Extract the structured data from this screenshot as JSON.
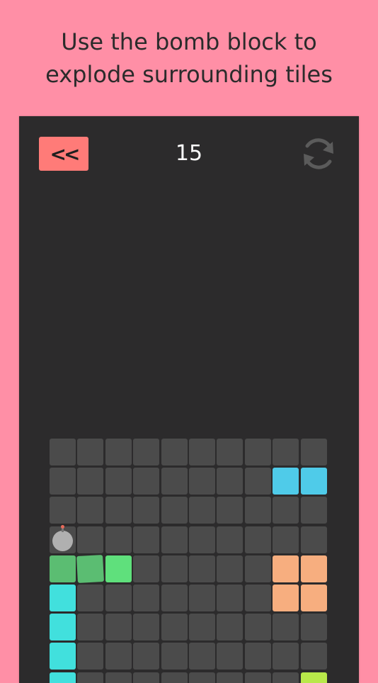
{
  "caption": {
    "line1": "Use the bomb block to",
    "line2": "explode surrounding tiles"
  },
  "header": {
    "back_label": "<<",
    "moves_count": "15",
    "restart_icon": "refresh-icon"
  },
  "board": {
    "columns": 10,
    "visible_rows": 9,
    "colors": {
      "empty": "#4b4b4b",
      "blue": "#4fcbe9",
      "cyan": "#41e0dd",
      "green": "#5bbd72",
      "light_green": "#5fe07c",
      "orange": "#f7ae7f",
      "lime": "#b8e84a",
      "bomb": "#b0b0b0"
    },
    "special_tiles": [
      {
        "row": 1,
        "col": 8,
        "color": "blue"
      },
      {
        "row": 1,
        "col": 9,
        "color": "blue"
      },
      {
        "row": 3,
        "col": 0,
        "color": "bomb"
      },
      {
        "row": 4,
        "col": 0,
        "color": "green"
      },
      {
        "row": 4,
        "col": 1,
        "color": "green",
        "tilted": true
      },
      {
        "row": 4,
        "col": 2,
        "color": "light_green"
      },
      {
        "row": 4,
        "col": 8,
        "color": "orange"
      },
      {
        "row": 4,
        "col": 9,
        "color": "orange"
      },
      {
        "row": 5,
        "col": 0,
        "color": "cyan"
      },
      {
        "row": 5,
        "col": 8,
        "color": "orange"
      },
      {
        "row": 5,
        "col": 9,
        "color": "orange"
      },
      {
        "row": 6,
        "col": 0,
        "color": "cyan"
      },
      {
        "row": 7,
        "col": 0,
        "color": "cyan"
      },
      {
        "row": 8,
        "col": 0,
        "color": "cyan"
      },
      {
        "row": 8,
        "col": 9,
        "color": "lime"
      }
    ]
  }
}
